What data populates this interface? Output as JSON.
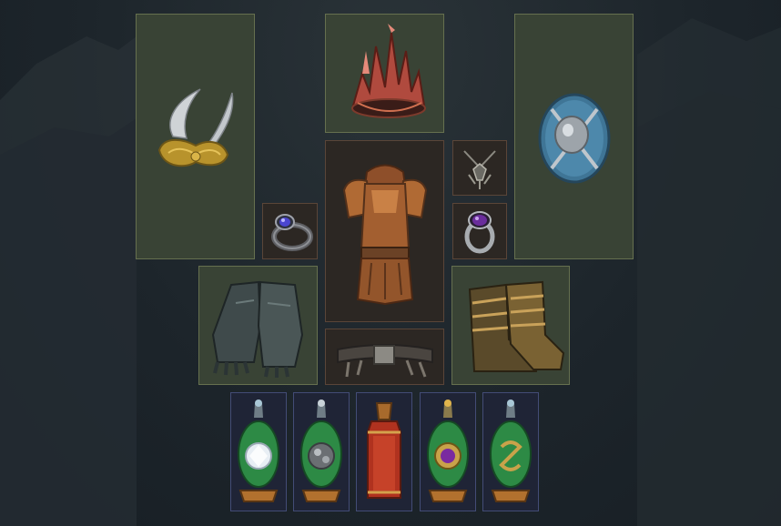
{
  "screen": {
    "view": "character-equipment",
    "background_color": "#1d252b"
  },
  "slot_colors": {
    "weapon_and_armour_bg": "#394335",
    "weapon_and_armour_border": "#66704f",
    "body_and_belt_bg": "#2c2723",
    "body_and_belt_border": "#5a4538",
    "flask_bg": "#1f2436",
    "flask_border": "#434c76"
  },
  "equipment": {
    "main_hand": {
      "slot": "weapon-main-hand",
      "icon": "claw-icon"
    },
    "helmet": {
      "slot": "helmet",
      "icon": "crystal-crown-icon"
    },
    "off_hand": {
      "slot": "weapon-off-hand",
      "icon": "round-shield-icon"
    },
    "amulet": {
      "slot": "amulet",
      "icon": "amulet-icon"
    },
    "ring_left": {
      "slot": "ring-left",
      "icon": "sapphire-ring-icon"
    },
    "body_armour": {
      "slot": "body-armour",
      "icon": "plate-armour-icon"
    },
    "ring_right": {
      "slot": "ring-right",
      "icon": "amethyst-ring-icon"
    },
    "gloves": {
      "slot": "gloves",
      "icon": "gauntlets-icon"
    },
    "belt": {
      "slot": "belt",
      "icon": "belt-icon"
    },
    "boots": {
      "slot": "boots",
      "icon": "plated-boots-icon"
    }
  },
  "flasks": [
    {
      "slot": "flask-1",
      "icon": "diamond-flask-icon",
      "color": "#2d8a45"
    },
    {
      "slot": "flask-2",
      "icon": "quicksilver-flask-icon",
      "color": "#2d8a45"
    },
    {
      "slot": "flask-3",
      "icon": "life-flask-icon",
      "color": "#b0321f"
    },
    {
      "slot": "flask-4",
      "icon": "amethyst-flask-icon",
      "color": "#2d8a45"
    },
    {
      "slot": "flask-5",
      "icon": "jade-flask-icon",
      "color": "#2d8a45"
    }
  ]
}
